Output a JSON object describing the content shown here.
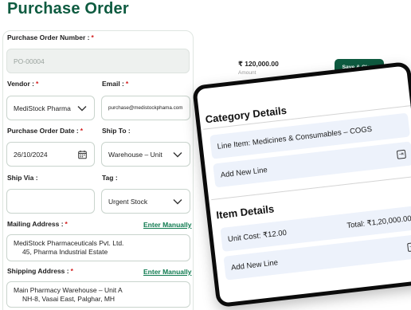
{
  "page": {
    "title": "Purchase Order"
  },
  "form": {
    "po_number": {
      "label": "Purchase Order Number :",
      "required": "*",
      "placeholder": "PO-00004"
    },
    "vendor": {
      "label": "Vendor :",
      "required": "*",
      "value": "MediStock Pharma"
    },
    "email": {
      "label": "Email :",
      "required": "*",
      "value": "purchase@medistockphama.com"
    },
    "po_date": {
      "label": "Purchase Order Date :",
      "required": "*",
      "value": "26/10/2024"
    },
    "ship_to": {
      "label": "Ship To :",
      "value": "Warehouse – Unit"
    },
    "ship_via": {
      "label": "Ship Via :",
      "value": ""
    },
    "tag": {
      "label": "Tag :",
      "value": "Urgent Stock"
    },
    "mailing_address": {
      "label": "Mailing Address :",
      "required": "*",
      "link": "Enter Manually",
      "line1": "MediStock Pharmaceuticals Pvt. Ltd.",
      "line2": "45, Pharma Industrial Estate"
    },
    "shipping_address": {
      "label": "Shipping Address :",
      "required": "*",
      "link": "Enter Manually",
      "line1": "Main Pharmacy Warehouse – Unit A",
      "line2": "NH-8, Vasai East, Palghar, MH"
    }
  },
  "summary": {
    "amount_value": "₹ 120,000.00",
    "amount_label": "Amount",
    "save_label": "Save & Close"
  },
  "zoom": {
    "category": {
      "title": "Category Details",
      "line_item": "Line Item: Medicines & Consumables – COGS",
      "add_line": "Add New Line"
    },
    "item": {
      "title": "Item Details",
      "unit_cost": "Unit Cost: ₹12.00",
      "total": "Total: ₹1,20,000.00",
      "add_line": "Add New Line"
    }
  },
  "icons": {
    "dropdown": "chevron-down-icon",
    "calendar": "calendar-icon",
    "add_line": "arrow-into-box-icon"
  },
  "colors": {
    "brand": "#0e5b40",
    "link": "#0e7a4f",
    "required": "#d21b1b",
    "row_bg": "#edf2fb"
  }
}
